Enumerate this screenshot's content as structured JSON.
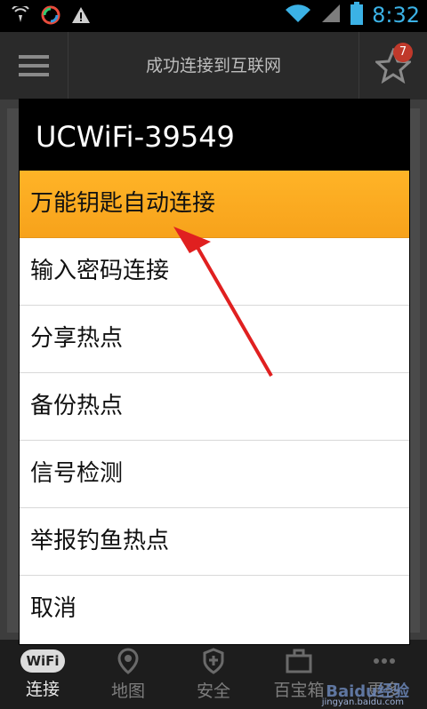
{
  "status_bar": {
    "time": "8:32",
    "icons": [
      "wifi-signal-icon",
      "app-logo-icon",
      "warning-icon",
      "wifi-icon",
      "cellular-signal-icon",
      "battery-icon"
    ]
  },
  "header": {
    "title": "成功连接到互联网",
    "badge_count": "7"
  },
  "dialog": {
    "title": "UCWiFi-39549",
    "items": [
      {
        "label": "万能钥匙自动连接",
        "highlighted": true
      },
      {
        "label": "输入密码连接"
      },
      {
        "label": "分享热点"
      },
      {
        "label": "备份热点"
      },
      {
        "label": "信号检测"
      },
      {
        "label": "举报钓鱼热点"
      },
      {
        "label": "取消"
      }
    ]
  },
  "bottom_nav": {
    "items": [
      {
        "label": "连接",
        "icon": "wifi-logo-icon",
        "logo_text": "WiFi"
      },
      {
        "label": "地图",
        "icon": "map-pin-icon"
      },
      {
        "label": "安全",
        "icon": "shield-icon"
      },
      {
        "label": "百宝箱",
        "icon": "toolbox-icon"
      },
      {
        "label": "更多",
        "icon": "more-icon"
      }
    ]
  },
  "watermark": {
    "text": "Baidu经验",
    "url_text": "jingyan.baidu.com"
  },
  "colors": {
    "highlight": "#f7a21b",
    "accent": "#3bb2e6",
    "arrow": "#e02020"
  }
}
